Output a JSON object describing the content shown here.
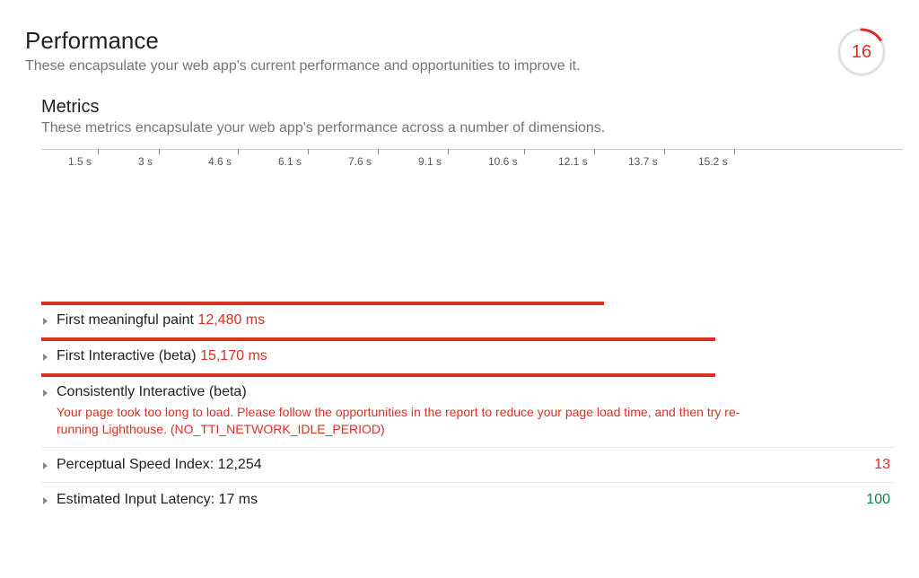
{
  "header": {
    "title": "Performance",
    "subtitle": "These encapsulate your web app's current performance and opportunities to improve it.",
    "score": "16"
  },
  "metrics": {
    "title": "Metrics",
    "subtitle": "These metrics encapsulate your web app's performance across a number of dimensions.",
    "timeline_ticks": [
      "1.5 s",
      "3 s",
      "4.6 s",
      "6.1 s",
      "7.6 s",
      "9.1 s",
      "10.6 s",
      "12.1 s",
      "13.7 s",
      "15.2 s"
    ],
    "items": [
      {
        "label": "First meaningful paint",
        "value": "12,480 ms",
        "bar_width_pct": 66
      },
      {
        "label": "First Interactive (beta)",
        "value": "15,170 ms",
        "bar_width_pct": 79
      },
      {
        "label": "Consistently Interactive (beta)",
        "message": "Your page took too long to load. Please follow the opportunities in the report to reduce your page load time, and then try re-running Lighthouse. (NO_TTI_NETWORK_IDLE_PERIOD)",
        "bar_width_pct": 79
      },
      {
        "label": "Perceptual Speed Index: 12,254",
        "side_score": "13",
        "side_class": "score-red"
      },
      {
        "label": "Estimated Input Latency: 17 ms",
        "side_score": "100",
        "side_class": "score-green"
      }
    ]
  }
}
